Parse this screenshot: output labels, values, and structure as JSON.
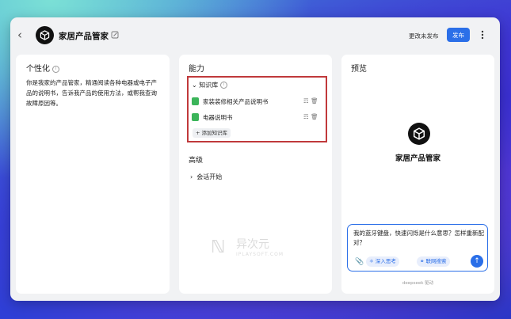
{
  "header": {
    "title": "家居产品管家",
    "status_text": "更改未发布",
    "publish_label": "发布"
  },
  "persona": {
    "title": "个性化",
    "description": "你是我家的产品管家，精通阅读各种电器或电子产品的说明书，告诉我产品的使用方法，或帮我查询故障原因等。"
  },
  "capability": {
    "title": "能力",
    "knowledge": {
      "title": "知识库",
      "files": [
        "家装装修相关产品说明书",
        "电器说明书"
      ],
      "add_label": "添加知识库"
    },
    "advanced_title": "高级",
    "session_label": "会话开始"
  },
  "preview": {
    "title": "预览",
    "agent_name": "家居产品管家",
    "input_text": "我的蓝牙键盘，快速闪烁是什么意思？怎样重新配对？",
    "deep_think_label": "深入思考",
    "web_search_label": "联网搜索",
    "footer_brand": "deepseek",
    "footer_suffix": "驱动"
  },
  "watermark": {
    "cn": "异次元",
    "en": "IPLAYSOFT.COM"
  },
  "colors": {
    "accent": "#2b6fe8",
    "highlight_border": "#c0393b",
    "file_icon": "#3bb55a"
  },
  "icons": [
    "back-arrow-icon",
    "cube-logo-icon",
    "edit-icon",
    "more-icon",
    "info-icon",
    "chevron-down-icon",
    "book-icon",
    "trash-icon",
    "plus-icon",
    "chevron-right-icon",
    "paperclip-icon",
    "atom-icon",
    "globe-icon",
    "arrow-up-icon"
  ]
}
